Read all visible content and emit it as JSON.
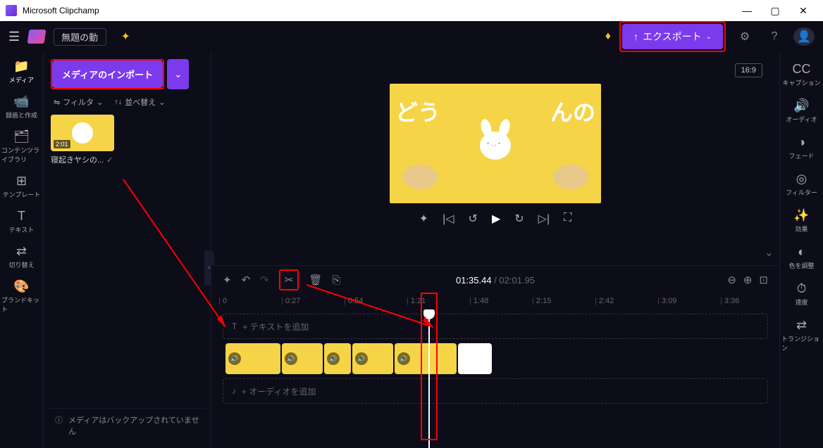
{
  "titlebar": {
    "title": "Microsoft Clipchamp"
  },
  "topbar": {
    "project_title": "無題の動",
    "export_label": "エクスポート"
  },
  "leftnav": [
    {
      "icon": "📁",
      "label": "メディア",
      "name": "nav-media",
      "active": true
    },
    {
      "icon": "📹",
      "label": "録画と作成",
      "name": "nav-record"
    },
    {
      "icon": "🗂",
      "label": "コンテンツライブラリ",
      "name": "nav-library"
    },
    {
      "icon": "⊞",
      "label": "テンプレート",
      "name": "nav-templates"
    },
    {
      "icon": "T",
      "label": "テキスト",
      "name": "nav-text"
    },
    {
      "icon": "⇄",
      "label": "切り替え",
      "name": "nav-transitions"
    },
    {
      "icon": "🎨",
      "label": "ブランドキット",
      "name": "nav-brand"
    }
  ],
  "rightnav": [
    {
      "icon": "CC",
      "label": "キャプション",
      "name": "rnav-captions"
    },
    {
      "icon": "🔊",
      "label": "オーディオ",
      "name": "rnav-audio"
    },
    {
      "icon": "◑",
      "label": "フェード",
      "name": "rnav-fade"
    },
    {
      "icon": "◎",
      "label": "フィルター",
      "name": "rnav-filter"
    },
    {
      "icon": "✨",
      "label": "効果",
      "name": "rnav-effects"
    },
    {
      "icon": "◐",
      "label": "色を調整",
      "name": "rnav-color"
    },
    {
      "icon": "⏱",
      "label": "速度",
      "name": "rnav-speed"
    },
    {
      "icon": "⇄",
      "label": "トランジション",
      "name": "rnav-transition"
    }
  ],
  "media": {
    "import_label": "メディアのインポート",
    "filter_label": "フィルタ",
    "sort_label": "並べ替え",
    "thumb_duration": "2:01",
    "thumb_name": "寝起きヤシの...",
    "backup_msg": "メディアはバックアップされていません"
  },
  "preview": {
    "aspect": "16:9",
    "jp_text_left": "どう",
    "jp_text_right": "んの"
  },
  "timeline": {
    "current": "01:35.44",
    "duration": "02:01.95",
    "ticks": [
      "0",
      "0:27",
      "0:54",
      "1:21",
      "1:48",
      "2:15",
      "2:42",
      "3:09",
      "3:36"
    ],
    "add_text": "テキストを追加",
    "add_audio": "オーディオを追加"
  }
}
